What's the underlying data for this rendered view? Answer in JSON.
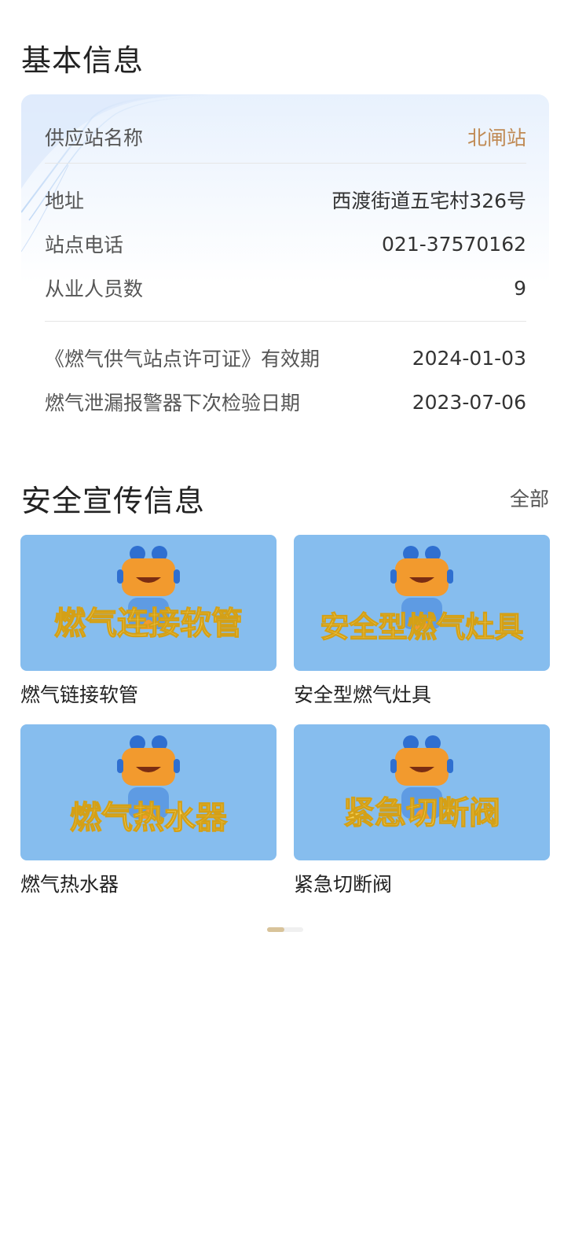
{
  "basic_info": {
    "title": "基本信息",
    "station_label": "供应站名称",
    "station_value": "北闸站",
    "address_label": "地址",
    "address_value": "西渡街道五宅村326号",
    "phone_label": "站点电话",
    "phone_value": "021-37570162",
    "staff_label": "从业人员数",
    "staff_value": "9",
    "license_label": "《燃气供气站点许可证》有效期",
    "license_value": "2024-01-03",
    "alarm_label": "燃气泄漏报警器下次检验日期",
    "alarm_value": "2023-07-06"
  },
  "promo": {
    "title": "安全宣传信息",
    "all_label": "全部",
    "items": [
      {
        "image_text": "燃气连接软管",
        "caption": "燃气链接软管"
      },
      {
        "image_text": "安全型燃气灶具",
        "caption": "安全型燃气灶具"
      },
      {
        "image_text": "燃气热水器",
        "caption": "燃气热水器"
      },
      {
        "image_text": "紧急切断阀",
        "caption": "紧急切断阀"
      }
    ]
  },
  "colors": {
    "accent": "#c08a54",
    "tile_bg": "#86bdee",
    "tile_text": "#f6d35a",
    "pager_active": "#d8c39a"
  }
}
